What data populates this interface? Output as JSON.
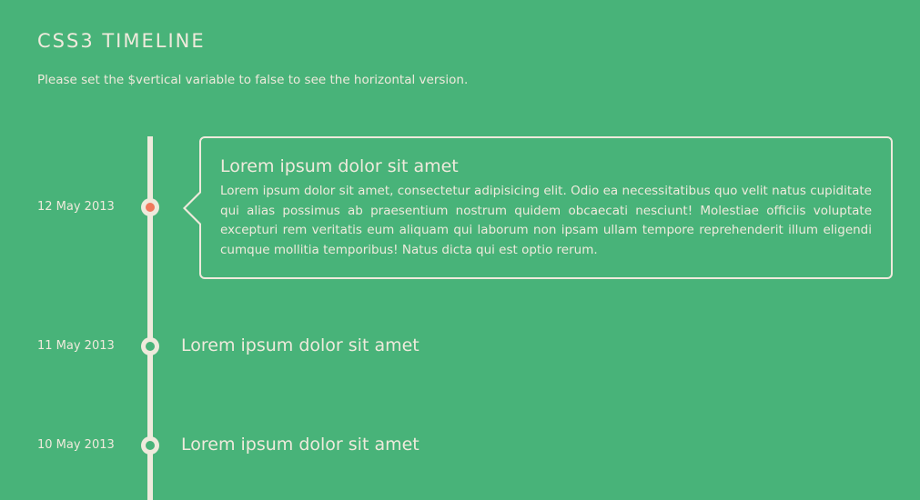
{
  "header": {
    "title": "CSS3 Timeline",
    "subtitle": "Please set the $vertical variable to false to see the horizontal version."
  },
  "events": [
    {
      "date": "12 May 2013",
      "title": "Lorem ipsum dolor sit amet",
      "body": "Lorem ipsum dolor sit amet, consectetur adipisicing elit. Odio ea necessitatibus quo velit natus cupiditate qui alias possimus ab praesentium nostrum quidem obcaecati nesciunt! Molestiae officiis voluptate excepturi rem veritatis eum aliquam qui laborum non ipsam ullam tempore reprehenderit illum eligendi cumque mollitia temporibus! Natus dicta qui est optio rerum.",
      "active": true
    },
    {
      "date": "11 May 2013",
      "title": "Lorem ipsum dolor sit amet"
    },
    {
      "date": "10 May 2013",
      "title": "Lorem ipsum dolor sit amet"
    }
  ],
  "colors": {
    "background": "#48b379",
    "foreground": "#efeadc",
    "active_dot": "#f0795c"
  }
}
